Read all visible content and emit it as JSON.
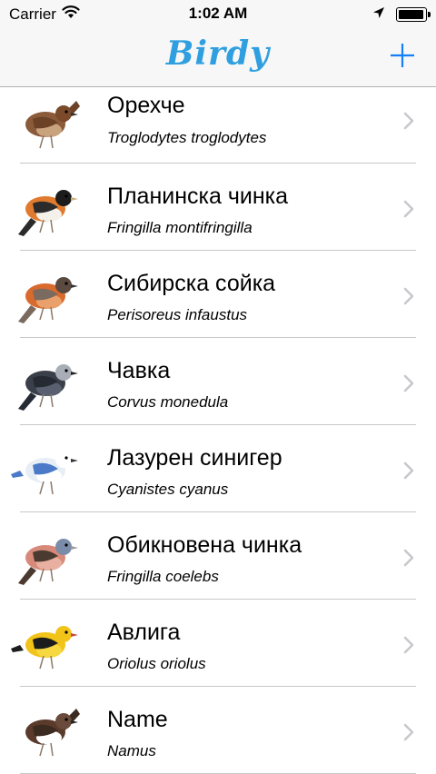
{
  "status_bar": {
    "carrier": "Carrier",
    "time": "1:02 AM",
    "battery_level": 0.95,
    "icons": [
      "wifi-icon",
      "location-arrow-icon",
      "battery-icon"
    ]
  },
  "nav": {
    "title": "Birdy",
    "add_icon": "plus-icon",
    "title_color": "#2f9fe0",
    "accent_color": "#157efb"
  },
  "birds": [
    {
      "name": "Орехче",
      "latin": "Troglodytes troglodytes",
      "image": "wren-image"
    },
    {
      "name": "Планинска чинка",
      "latin": "Fringilla montifringilla",
      "image": "brambling-image"
    },
    {
      "name": "Сибирска сойка",
      "latin": "Perisoreus infaustus",
      "image": "siberian-jay-image"
    },
    {
      "name": "Чавка",
      "latin": "Corvus monedula",
      "image": "jackdaw-image"
    },
    {
      "name": "Лазурен синигер",
      "latin": "Cyanistes cyanus",
      "image": "azure-tit-image"
    },
    {
      "name": "Обикновена чинка",
      "latin": "Fringilla coelebs",
      "image": "chaffinch-image"
    },
    {
      "name": "Авлига",
      "latin": "Oriolus oriolus",
      "image": "oriole-image"
    },
    {
      "name": "Name",
      "latin": "Namus",
      "image": "dipper-image"
    }
  ]
}
